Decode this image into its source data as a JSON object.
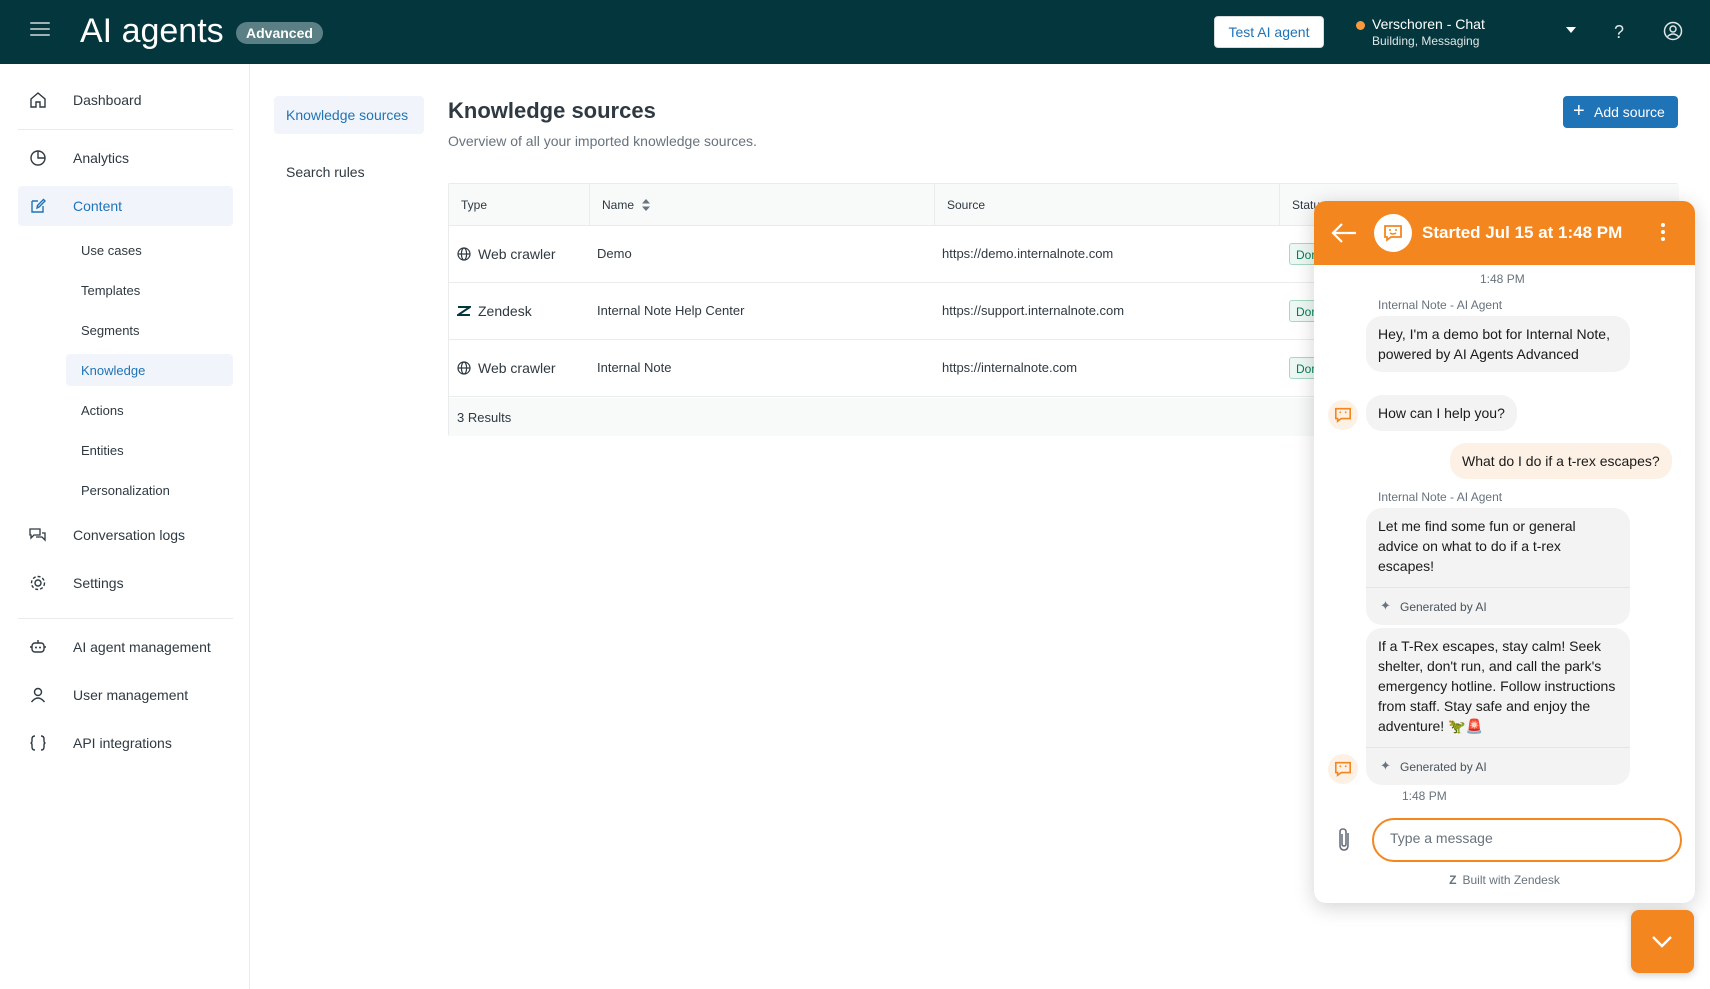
{
  "header": {
    "title": "AI agents",
    "badge": "Advanced",
    "test_button": "Test AI agent",
    "account_name": "Verschoren - Chat",
    "account_sub": "Building, Messaging",
    "help": "?"
  },
  "sidebar": {
    "dashboard": "Dashboard",
    "analytics": "Analytics",
    "content": "Content",
    "content_items": [
      "Use cases",
      "Templates",
      "Segments",
      "Knowledge",
      "Actions",
      "Entities",
      "Personalization"
    ],
    "conversation_logs": "Conversation logs",
    "settings": "Settings",
    "agent_management": "AI agent management",
    "user_management": "User management",
    "api_integrations": "API integrations"
  },
  "subnav": {
    "knowledge_sources": "Knowledge sources",
    "search_rules": "Search rules"
  },
  "main": {
    "title": "Knowledge sources",
    "subtitle": "Overview of all your imported knowledge sources.",
    "add_button": "Add source",
    "columns": [
      "Type",
      "Name",
      "Source",
      "Statu"
    ],
    "rows": [
      {
        "type": "Web crawler",
        "name": "Demo",
        "source": "https://demo.internalnote.com",
        "status": "Don"
      },
      {
        "type": "Zendesk",
        "name": "Internal Note Help Center",
        "source": "https://support.internalnote.com",
        "status": "Don"
      },
      {
        "type": "Web crawler",
        "name": "Internal Note",
        "source": "https://internalnote.com",
        "status": "Don"
      }
    ],
    "results": "3 Results"
  },
  "chat": {
    "title": "Started Jul 15 at 1:48 PM",
    "time_top": "1:48 PM",
    "sender": "Internal Note - AI Agent",
    "msg1": "Hey, I'm a demo bot for Internal Note, powered by AI Agents Advanced",
    "msg2": "How can I help you?",
    "user_msg": "What do I do if a t-rex escapes?",
    "sender2": "Internal Note - AI Agent",
    "msg3": "Let me find some fun or general advice on what to do if a t-rex escapes!",
    "gen1": "Generated by AI",
    "msg4": "If a T-Rex escapes, stay calm! Seek shelter, don't run, and call the park's emergency hotline. Follow instructions from staff. Stay safe and enjoy the adventure! 🦖🚨",
    "gen2": "Generated by AI",
    "time_bottom": "1:48 PM",
    "input_placeholder": "Type a message",
    "built_with": "Built with Zendesk"
  },
  "colors": {
    "header_bg": "#03363d",
    "accent": "#1f73b7",
    "chat_orange": "#f4861f"
  }
}
